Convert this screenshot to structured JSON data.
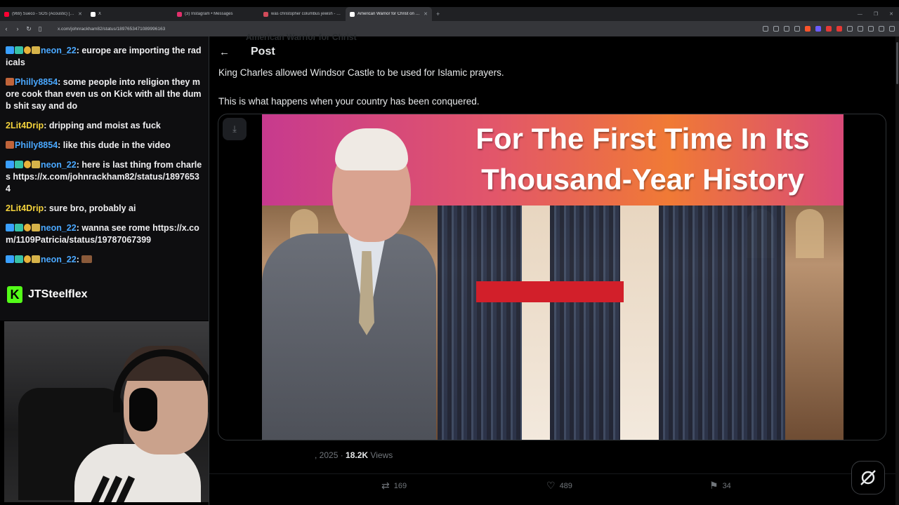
{
  "browser": {
    "tabs": [
      {
        "title": "(969) Sueco - SOS (Acoustic) [Offici...",
        "color": "#ff0033",
        "active": false
      },
      {
        "title": "X",
        "color": "#ffffff",
        "active": false
      },
      {
        "title": "(3) Instagram • Messages",
        "color": "#e1306c",
        "active": false
      },
      {
        "title": "was christopher columbus jewish - B...",
        "color": "#d14b5a",
        "active": false
      },
      {
        "title": "American Warrior for Christ on X...",
        "color": "#ffffff",
        "active": true
      }
    ],
    "new_tab": "+",
    "url": "x.com/johnrackham82/status/1897653471089996163"
  },
  "chat": {
    "messages": [
      {
        "user": "neon_22",
        "user_color": "#4aa8ff",
        "text": ": europe are importing the radicals",
        "badges": [
          "blue",
          "teal",
          "gold",
          "yel"
        ]
      },
      {
        "user": "Philly8854",
        "user_color": "#4aa8ff",
        "text": ": some people into religion they more cook than even us on Kick with all the dumb shit say and do",
        "badges": [
          "red"
        ]
      },
      {
        "user": "2Lit4Drip",
        "user_color": "#f3d23c",
        "text": ": dripping and moist as fuck",
        "badges": []
      },
      {
        "user": "Philly8854",
        "user_color": "#4aa8ff",
        "text": ": like this dude in the video",
        "badges": [
          "red"
        ]
      },
      {
        "user": "neon_22",
        "user_color": "#4aa8ff",
        "text": ": here is last thing from charles https://x.com/johnrackham82/status/18976534",
        "badges": [
          "blue",
          "teal",
          "gold",
          "yel"
        ]
      },
      {
        "user": "2Lit4Drip",
        "user_color": "#f3d23c",
        "text": ": sure bro, probably ai",
        "badges": []
      },
      {
        "user": "neon_22",
        "user_color": "#4aa8ff",
        "text": ": wanna see rome https://x.com/1109Patricia/status/19787067399",
        "badges": [
          "blue",
          "teal",
          "gold",
          "yel"
        ]
      },
      {
        "user": "neon_22",
        "user_color": "#4aa8ff",
        "text": ":",
        "badges": [
          "blue",
          "teal",
          "gold",
          "yel"
        ],
        "emote": true
      }
    ],
    "channel": {
      "logo": "K",
      "name": "JTSteelflex"
    }
  },
  "post": {
    "back": "←",
    "header_title": "Post",
    "ghost_author": "American Warrior for Christ",
    "text_line1": "King Charles allowed Windsor Castle to be used for Islamic prayers.",
    "text_line2": "This is what happens when your country has been conquered.",
    "download_icon": "⤓",
    "image_banner_line1": "For The First Time In Its",
    "image_banner_line2": "Thousand-Year History",
    "date_fragment": ", 2025 · ",
    "views_count": "18.2K",
    "views_label": "Views",
    "actions": {
      "retweets": "169",
      "likes": "489",
      "bookmarks": "34"
    }
  }
}
